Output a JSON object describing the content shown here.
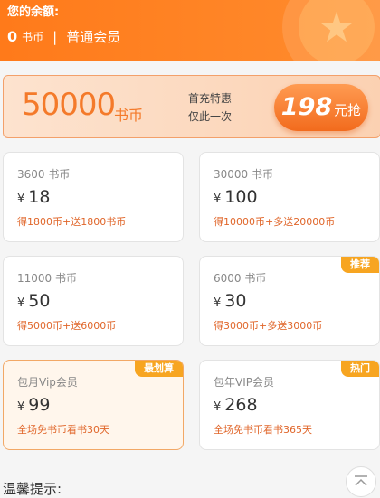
{
  "header": {
    "balance_label": "您的余额:",
    "balance_value": "0",
    "balance_unit": "书币",
    "separator": "|",
    "member_level": "普通会员"
  },
  "promo": {
    "amount": "50000",
    "amount_unit": "书币",
    "line1": "首充特惠",
    "line2": "仅此一次",
    "price": "198",
    "price_unit": "元抢"
  },
  "currency_symbol": "¥",
  "cards": [
    {
      "name": "3600 书币",
      "price": "18",
      "bonus": "得1800币+送1800书币",
      "tag": ""
    },
    {
      "name": "30000 书币",
      "price": "100",
      "bonus": "得10000币+多送20000币",
      "tag": ""
    },
    {
      "name": "11000 书币",
      "price": "50",
      "bonus": "得5000币+送6000币",
      "tag": ""
    },
    {
      "name": "6000 书币",
      "price": "30",
      "bonus": "得3000币+多送3000币",
      "tag": "推荐"
    },
    {
      "name": "包月Vip会员",
      "price": "99",
      "bonus": "全场免书币看书30天",
      "tag": "最划算"
    },
    {
      "name": "包年VIP会员",
      "price": "268",
      "bonus": "全场免书币看书365天",
      "tag": "热门"
    }
  ],
  "tips_title": "温馨提示:",
  "icons": {
    "coin": "coin-star-icon",
    "back_to_top": "back-to-top-icon"
  },
  "colors": {
    "accent": "#ff7a1a",
    "tag": "#f7a521",
    "bonus_text": "#e0662a"
  }
}
